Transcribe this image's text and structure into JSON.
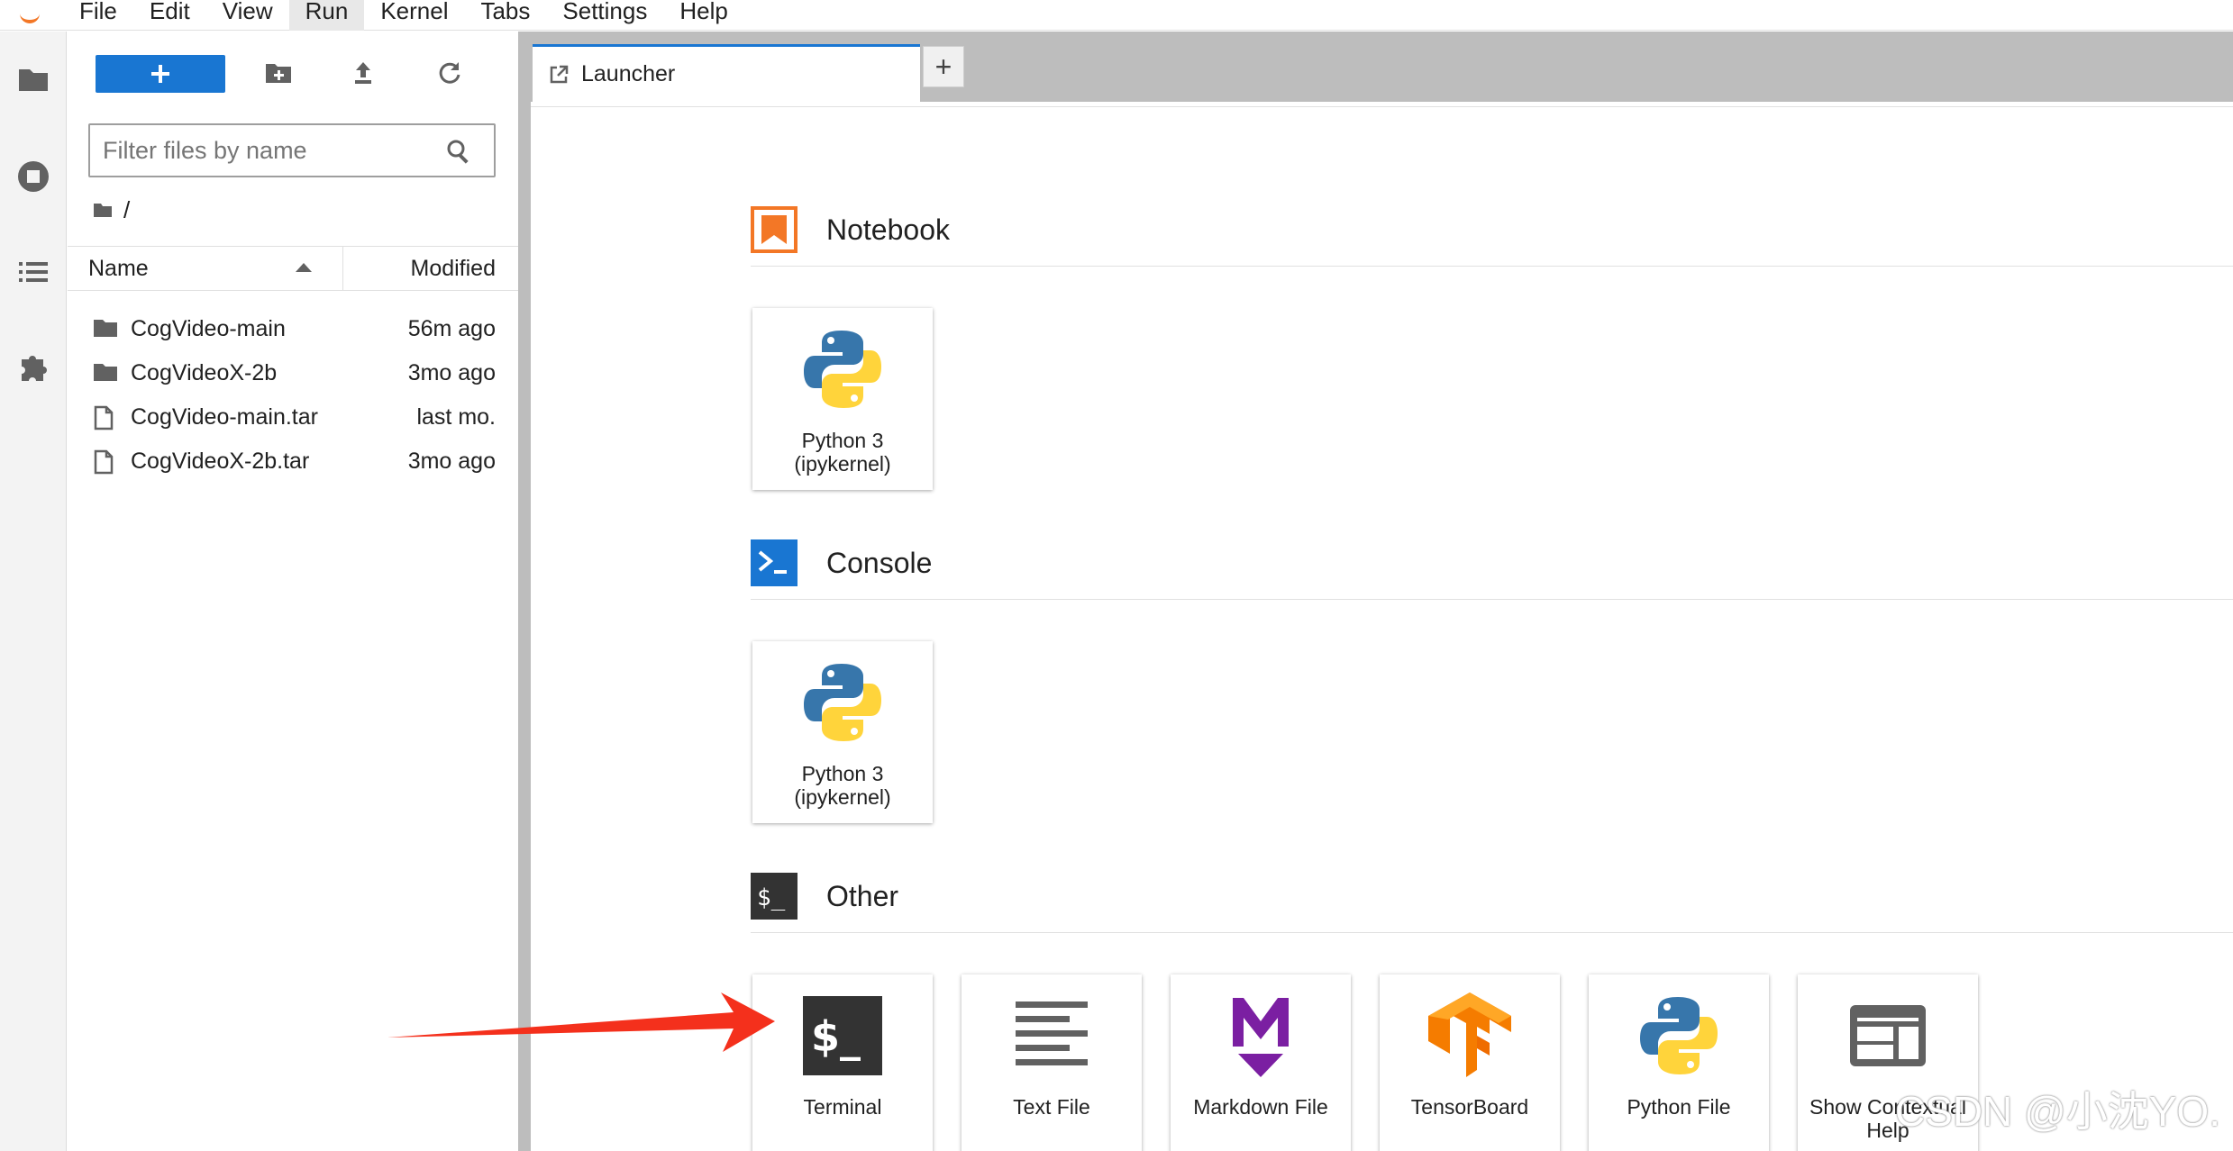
{
  "menubar": {
    "items": [
      "File",
      "Edit",
      "View",
      "Run",
      "Kernel",
      "Tabs",
      "Settings",
      "Help"
    ],
    "active": "Run"
  },
  "filebrowser": {
    "filter_placeholder": "Filter files by name",
    "breadcrumb": "/",
    "columns": {
      "name": "Name",
      "modified": "Modified"
    },
    "files": [
      {
        "name": "CogVideo-main",
        "modified": "56m ago",
        "type": "folder"
      },
      {
        "name": "CogVideoX-2b",
        "modified": "3mo ago",
        "type": "folder"
      },
      {
        "name": "CogVideo-main.tar",
        "modified": "last mo.",
        "type": "file"
      },
      {
        "name": "CogVideoX-2b.tar",
        "modified": "3mo ago",
        "type": "file"
      }
    ]
  },
  "tabs": {
    "active_label": "Launcher",
    "add_label": "+"
  },
  "launcher": {
    "sections": [
      {
        "title": "Notebook",
        "cards": [
          {
            "line1": "Python 3",
            "line2": "(ipykernel)"
          }
        ]
      },
      {
        "title": "Console",
        "cards": [
          {
            "line1": "Python 3",
            "line2": "(ipykernel)"
          }
        ]
      },
      {
        "title": "Other",
        "cards": [
          {
            "line1": "Terminal",
            "line2": ""
          },
          {
            "line1": "Text File",
            "line2": ""
          },
          {
            "line1": "Markdown File",
            "line2": ""
          },
          {
            "line1": "TensorBoard",
            "line2": ""
          },
          {
            "line1": "Python File",
            "line2": ""
          },
          {
            "line1": "Show Contextual",
            "line2": "Help"
          }
        ]
      }
    ]
  },
  "watermark": "CSDN @小沈YO.",
  "colors": {
    "accent": "#1976d2",
    "notebook_orange": "#f37726",
    "console_blue": "#1976d2",
    "markdown_purple": "#7b1fa2",
    "annotation_arrow": "#f4301c"
  }
}
